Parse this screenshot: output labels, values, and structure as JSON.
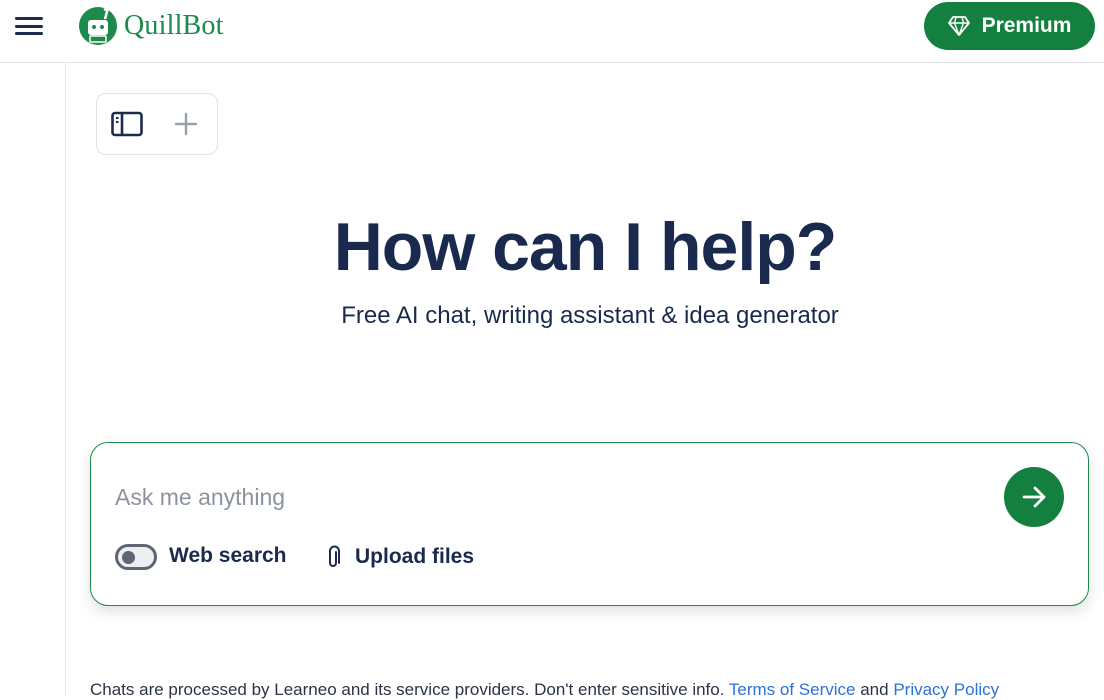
{
  "header": {
    "brand_name": "QuillBot",
    "premium_label": "Premium",
    "brand_color": "#14803f"
  },
  "toolbar": {
    "panel_icon": "sidebar-panel-icon",
    "new_chat_icon": "plus-icon"
  },
  "hero": {
    "title": "How can I help?",
    "subtitle": "Free AI chat, writing assistant & idea generator"
  },
  "chat": {
    "placeholder": "Ask me anything",
    "value": "",
    "web_search_label": "Web search",
    "web_search_enabled": false,
    "upload_label": "Upload files",
    "send_icon": "arrow-right-icon"
  },
  "footer": {
    "disclaimer": "Chats are processed by Learneo and its service providers. Don't enter sensitive info.",
    "terms_label": "Terms of Service",
    "and_text": "and",
    "privacy_label": "Privacy Policy"
  }
}
